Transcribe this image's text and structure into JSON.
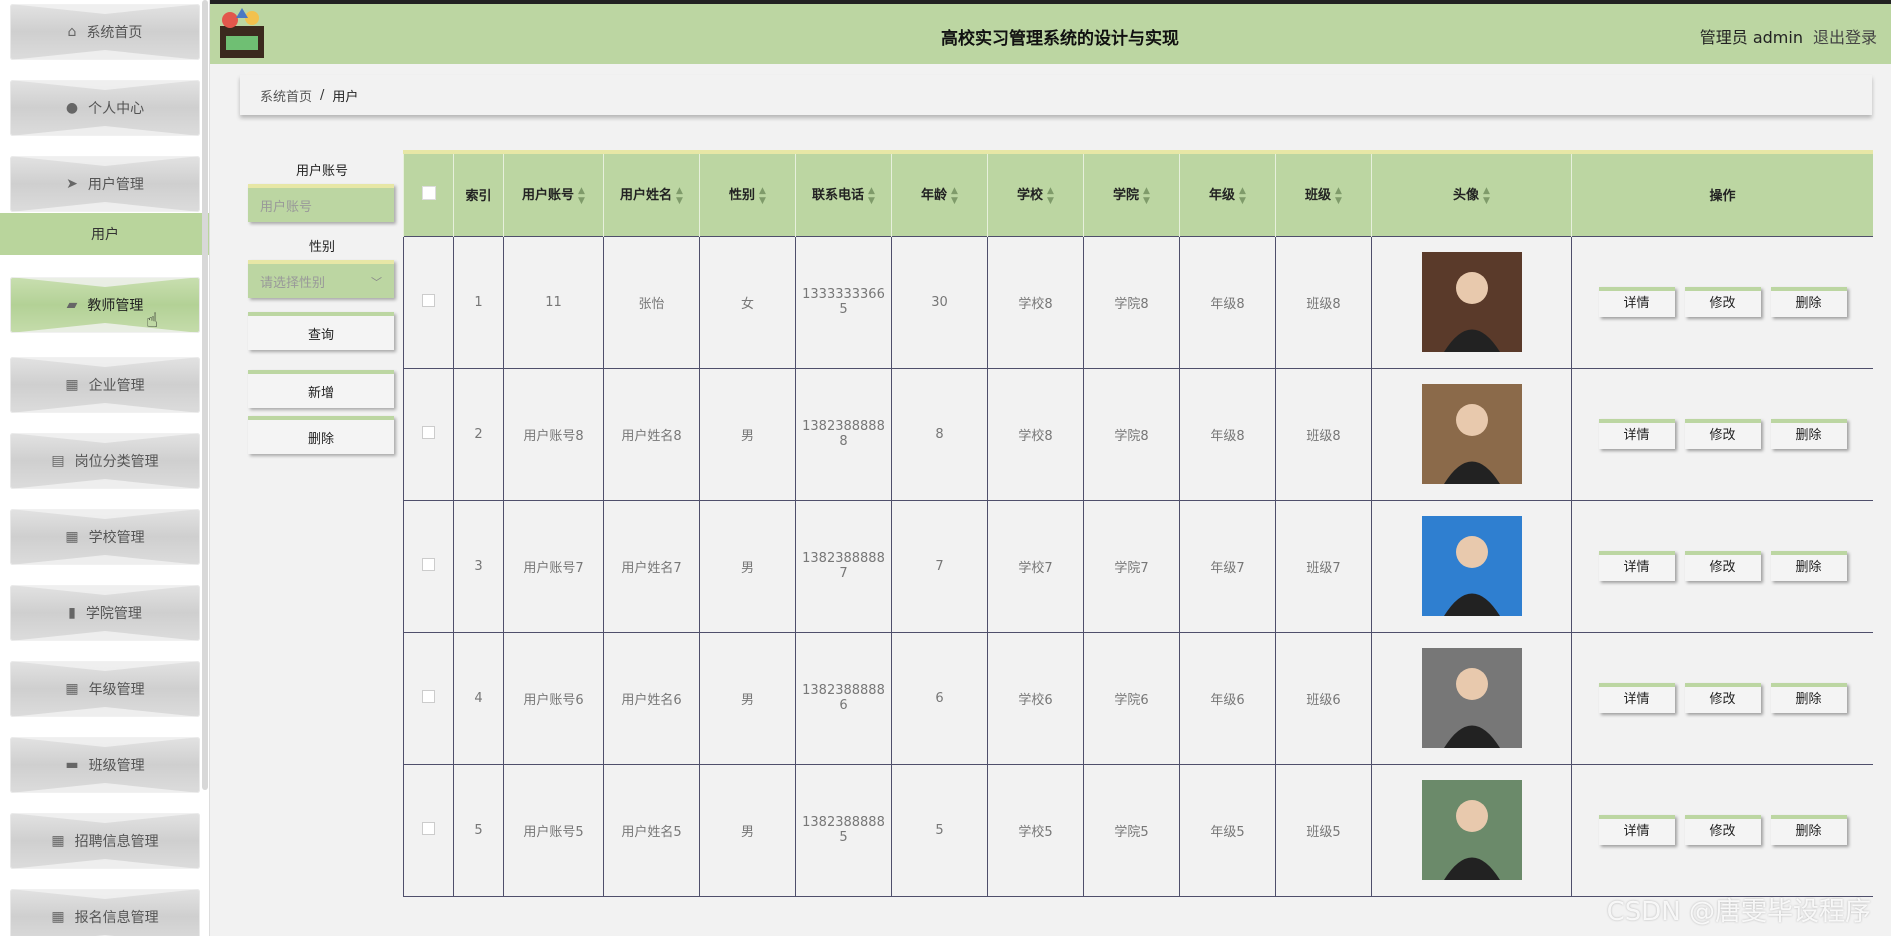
{
  "app": {
    "title": "高校实习管理系统的设计与实现",
    "user_label": "管理员 admin",
    "logout_label": "退出登录"
  },
  "sidebar": {
    "items": [
      {
        "label": "系统首页",
        "icon": "home-icon",
        "glyph": "⌂"
      },
      {
        "label": "个人中心",
        "icon": "user-icon",
        "glyph": "●"
      },
      {
        "label": "用户管理",
        "icon": "send-icon",
        "glyph": "➤"
      },
      {
        "label": "教师管理",
        "icon": "teacher-icon",
        "glyph": "▰"
      },
      {
        "label": "企业管理",
        "icon": "grid-icon",
        "glyph": "▦"
      },
      {
        "label": "岗位分类管理",
        "icon": "briefcase-icon",
        "glyph": "▤"
      },
      {
        "label": "学校管理",
        "icon": "grid-icon",
        "glyph": "▦"
      },
      {
        "label": "学院管理",
        "icon": "bar-chart-icon",
        "glyph": "▮"
      },
      {
        "label": "年级管理",
        "icon": "grid-icon",
        "glyph": "▦"
      },
      {
        "label": "班级管理",
        "icon": "chat-icon",
        "glyph": "▬"
      },
      {
        "label": "招聘信息管理",
        "icon": "grid-icon",
        "glyph": "▦"
      },
      {
        "label": "报名信息管理",
        "icon": "grid-icon",
        "glyph": "▦"
      }
    ],
    "submenu_label": "用户"
  },
  "breadcrumb": {
    "home": "系统首页",
    "separator": "/",
    "current": "用户"
  },
  "search": {
    "account_label": "用户账号",
    "account_placeholder": "用户账号",
    "gender_label": "性别",
    "gender_placeholder": "请选择性别",
    "query_button": "查询",
    "add_button": "新增",
    "delete_button": "删除"
  },
  "table": {
    "columns": [
      "索引",
      "用户账号",
      "用户姓名",
      "性别",
      "联系电话",
      "年龄",
      "学校",
      "学院",
      "年级",
      "班级",
      "头像",
      "操作"
    ],
    "actions": {
      "detail": "详情",
      "edit": "修改",
      "delete": "删除"
    },
    "rows": [
      {
        "index": "1",
        "account": "11",
        "name": "张怡",
        "gender": "女",
        "phone": "13333333665",
        "age": "30",
        "school": "学校8",
        "college": "学院8",
        "grade": "年级8",
        "class": "班级8",
        "avatar_color": "#5a3a2a"
      },
      {
        "index": "2",
        "account": "用户账号8",
        "name": "用户姓名8",
        "gender": "男",
        "phone": "13823888888",
        "age": "8",
        "school": "学校8",
        "college": "学院8",
        "grade": "年级8",
        "class": "班级8",
        "avatar_color": "#8b6a4a"
      },
      {
        "index": "3",
        "account": "用户账号7",
        "name": "用户姓名7",
        "gender": "男",
        "phone": "13823888887",
        "age": "7",
        "school": "学校7",
        "college": "学院7",
        "grade": "年级7",
        "class": "班级7",
        "avatar_color": "#2f7fd0"
      },
      {
        "index": "4",
        "account": "用户账号6",
        "name": "用户姓名6",
        "gender": "男",
        "phone": "13823888886",
        "age": "6",
        "school": "学校6",
        "college": "学院6",
        "grade": "年级6",
        "class": "班级6",
        "avatar_color": "#777777"
      },
      {
        "index": "5",
        "account": "用户账号5",
        "name": "用户姓名5",
        "gender": "男",
        "phone": "13823888885",
        "age": "5",
        "school": "学校5",
        "college": "学院5",
        "grade": "年级5",
        "class": "班级5",
        "avatar_color": "#6b8a6a"
      }
    ]
  },
  "watermark": "CSDN @唐雯毕设程序",
  "colors": {
    "accent": "#bcd6a2",
    "accent_border": "#e7e7a6",
    "background": "#f2f2f2"
  }
}
